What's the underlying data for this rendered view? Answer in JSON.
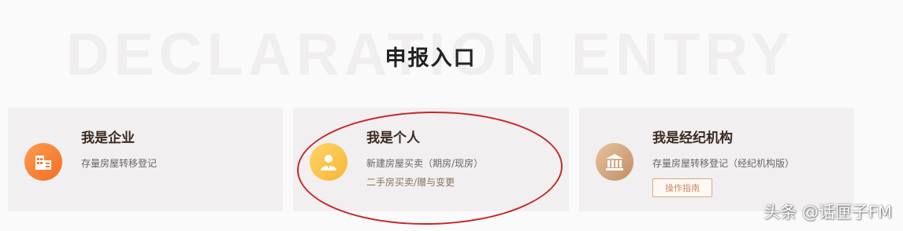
{
  "background_title": "DECLARATION ENTRY",
  "title": "申报入口",
  "cards": [
    {
      "key": "company",
      "title": "我是企业",
      "subtitle": "存量房屋转移登记",
      "icon": "building-icon",
      "color": "#f27a2c"
    },
    {
      "key": "person",
      "title": "我是个人",
      "subtitle": "新建房屋买卖（期房/现房）",
      "subtitle2": "二手房买卖/赠与变更",
      "icon": "person-icon",
      "color": "#f7bb3a"
    },
    {
      "key": "agency",
      "title": "我是经纪机构",
      "subtitle": "存量房屋转移登记（经纪机构版）",
      "button": "操作指南",
      "icon": "bank-icon",
      "color": "#c99466"
    }
  ],
  "watermark": "头条 @话匣子FM",
  "highlight_color": "#c62828"
}
